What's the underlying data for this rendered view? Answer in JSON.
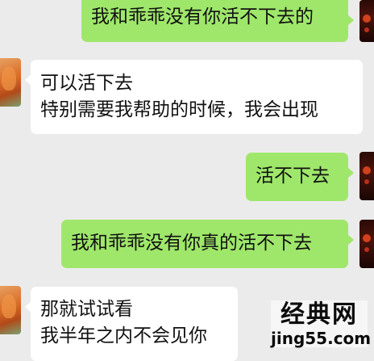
{
  "conversation": {
    "messages": [
      {
        "side": "sent",
        "lines": [
          "我和乖乖没有你活不下去的"
        ]
      },
      {
        "side": "received",
        "lines": [
          "可以活下去",
          "特别需要我帮助的时候，我会出现"
        ]
      },
      {
        "side": "sent",
        "lines": [
          "活不下去"
        ]
      },
      {
        "side": "sent",
        "lines": [
          "我和乖乖没有你真的活不下去"
        ]
      },
      {
        "side": "received",
        "lines": [
          "那就试试看",
          "我半年之内不会见你"
        ]
      }
    ]
  },
  "watermark": {
    "title": "经典网",
    "domain": "jing55.com"
  },
  "colors": {
    "background": "#ebebeb",
    "sent_bubble": "#9fe76a",
    "received_bubble": "#ffffff"
  }
}
